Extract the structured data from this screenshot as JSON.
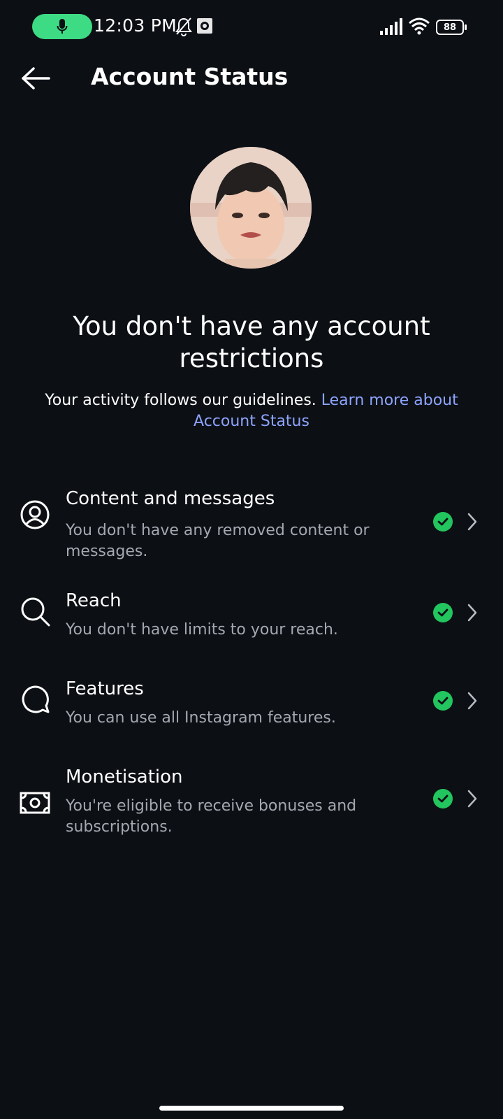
{
  "status_bar": {
    "time": "12:03 PM",
    "battery": "88",
    "icons": [
      "mic-icon",
      "bell-off-icon",
      "app-notification-icon",
      "signal-icon",
      "wifi-icon",
      "battery-icon"
    ]
  },
  "header": {
    "title": "Account Status",
    "back_icon": "arrow-left-icon"
  },
  "main": {
    "headline": "You don't have any account restrictions",
    "subtext": "Your activity follows our guidelines.",
    "link_text": "Learn more about Account Status",
    "link_color": "#8da4ff"
  },
  "items": [
    {
      "title": "Content and messages",
      "description": "You don't have any removed content or messages.",
      "icon": "user-circle-icon"
    },
    {
      "title": "Reach",
      "description": "You don't have limits to your reach.",
      "icon": "search-icon"
    },
    {
      "title": "Features",
      "description": "You can use all Instagram features.",
      "icon": "chat-bubble-icon"
    },
    {
      "title": "Monetisation",
      "description": "You're eligible to receive bonuses and subscriptions.",
      "icon": "money-icon"
    }
  ],
  "colors": {
    "background": "#0c0f14",
    "accent_green": "#22c55e",
    "mic_pill": "#3ddc84",
    "secondary_text": "#a4a8b0"
  }
}
